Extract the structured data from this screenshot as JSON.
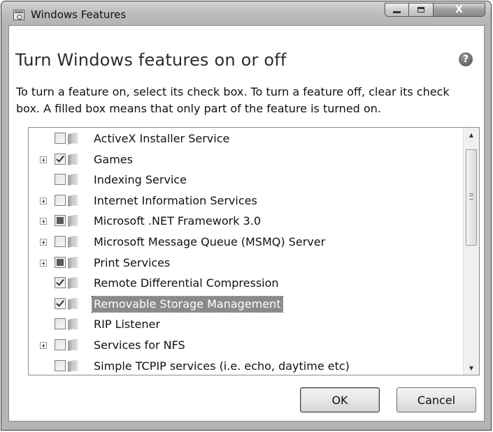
{
  "window": {
    "title": "Windows Features",
    "caption_buttons": [
      "minimize",
      "maximize",
      "close"
    ],
    "close_glyph": "X"
  },
  "dialog": {
    "heading": "Turn Windows features on or off",
    "help_glyph": "?",
    "description": "To turn a feature on, select its check box. To turn a feature off, clear its check box. A filled box means that only part of the feature is turned on."
  },
  "features": [
    {
      "label": "ActiveX Installer Service",
      "expandable": false,
      "state": "unchecked"
    },
    {
      "label": "Games",
      "expandable": true,
      "state": "checked"
    },
    {
      "label": "Indexing Service",
      "expandable": false,
      "state": "unchecked"
    },
    {
      "label": "Internet Information Services",
      "expandable": true,
      "state": "unchecked"
    },
    {
      "label": "Microsoft .NET Framework 3.0",
      "expandable": true,
      "state": "partial"
    },
    {
      "label": "Microsoft Message Queue (MSMQ) Server",
      "expandable": true,
      "state": "unchecked"
    },
    {
      "label": "Print Services",
      "expandable": true,
      "state": "partial"
    },
    {
      "label": "Remote Differential Compression",
      "expandable": false,
      "state": "checked"
    },
    {
      "label": "Removable Storage Management",
      "expandable": false,
      "state": "checked",
      "selected": true
    },
    {
      "label": "RIP Listener",
      "expandable": false,
      "state": "unchecked"
    },
    {
      "label": "Services for NFS",
      "expandable": true,
      "state": "unchecked"
    },
    {
      "label": "Simple TCPIP services (i.e. echo, daytime etc)",
      "expandable": false,
      "state": "unchecked"
    }
  ],
  "buttons": {
    "ok": "OK",
    "cancel": "Cancel"
  },
  "scroll": {
    "up_glyph": "▲",
    "down_glyph": "▼"
  },
  "colors": {
    "selection": "#8a8a8a",
    "window_frame": "#b4b4b4"
  }
}
